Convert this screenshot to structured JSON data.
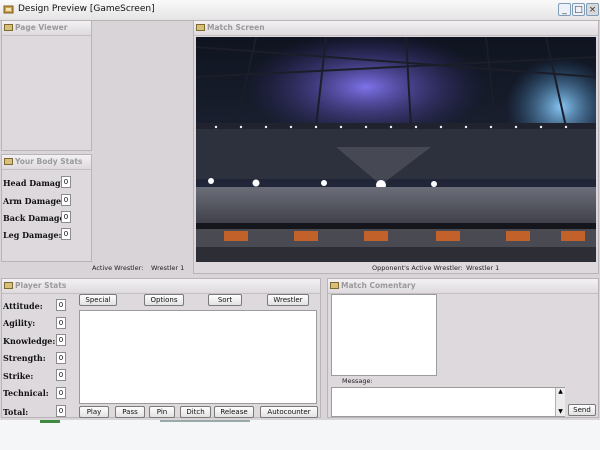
{
  "window": {
    "title": "Design Preview [GameScreen]"
  },
  "page_viewer": {
    "title": "Page Viewer"
  },
  "match_screen": {
    "title": "Match Screen",
    "active_label": "Active Wrestler:",
    "active_value": "Wrestler 1",
    "opponent_label": "Opponent's Active Wrestler:",
    "opponent_value": "Wrestler 1"
  },
  "body_stats": {
    "title": "Your Body Stats",
    "items": [
      {
        "label": "Head Damage:",
        "value": "0"
      },
      {
        "label": "Arm Damage:",
        "value": "0"
      },
      {
        "label": "Back Damage:",
        "value": "0"
      },
      {
        "label": "Leg Damage:",
        "value": "0"
      }
    ]
  },
  "player_stats": {
    "title": "Player Stats",
    "items": [
      {
        "label": "Attitude:",
        "value": "0"
      },
      {
        "label": "Agility:",
        "value": "0"
      },
      {
        "label": "Knowledge:",
        "value": "0"
      },
      {
        "label": "Strength:",
        "value": "0"
      },
      {
        "label": "Strike:",
        "value": "0"
      },
      {
        "label": "Technical:",
        "value": "0"
      },
      {
        "label": "Total:",
        "value": "0"
      }
    ],
    "top_buttons": [
      "Special",
      "Options",
      "Sort",
      "Wrestler"
    ],
    "bottom_buttons": [
      "Play",
      "Pass",
      "Pin",
      "Ditch",
      "Release",
      "Autocounter"
    ]
  },
  "commentary": {
    "title": "Match Comentary",
    "message_label": "Message:",
    "send_label": "Send"
  }
}
